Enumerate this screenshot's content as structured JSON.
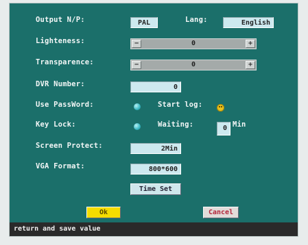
{
  "settings": {
    "output_label": "Output N/P:",
    "output_value": "PAL",
    "lang_label": "Lang:",
    "lang_value": "English",
    "lighteness_label": "Lighteness:",
    "lighteness_value": "0",
    "transparence_label": "Transparence:",
    "transparence_value": "0",
    "dvr_label": "DVR Number:",
    "dvr_value": "0",
    "password_label": "Use PassWord:",
    "start_log_label": "Start log:",
    "keylock_label": "Key Lock:",
    "waiting_label": "Waiting:",
    "waiting_value": "0",
    "waiting_unit": "Min",
    "screen_protect_label": "Screen Protect:",
    "screen_protect_value": "2Min",
    "vga_label": "VGA Format:",
    "vga_value": "800*600",
    "minus_glyph": "−",
    "plus_glyph": "+"
  },
  "buttons": {
    "time_set": "Time Set",
    "ok": "Ok",
    "cancel": "Cancel"
  },
  "status": {
    "text": "return and save value"
  },
  "colors": {
    "panel": "#1b6f6a",
    "field": "#cde9ef",
    "ok_button": "#f5dd00",
    "status_bar": "#2a2a2a"
  }
}
